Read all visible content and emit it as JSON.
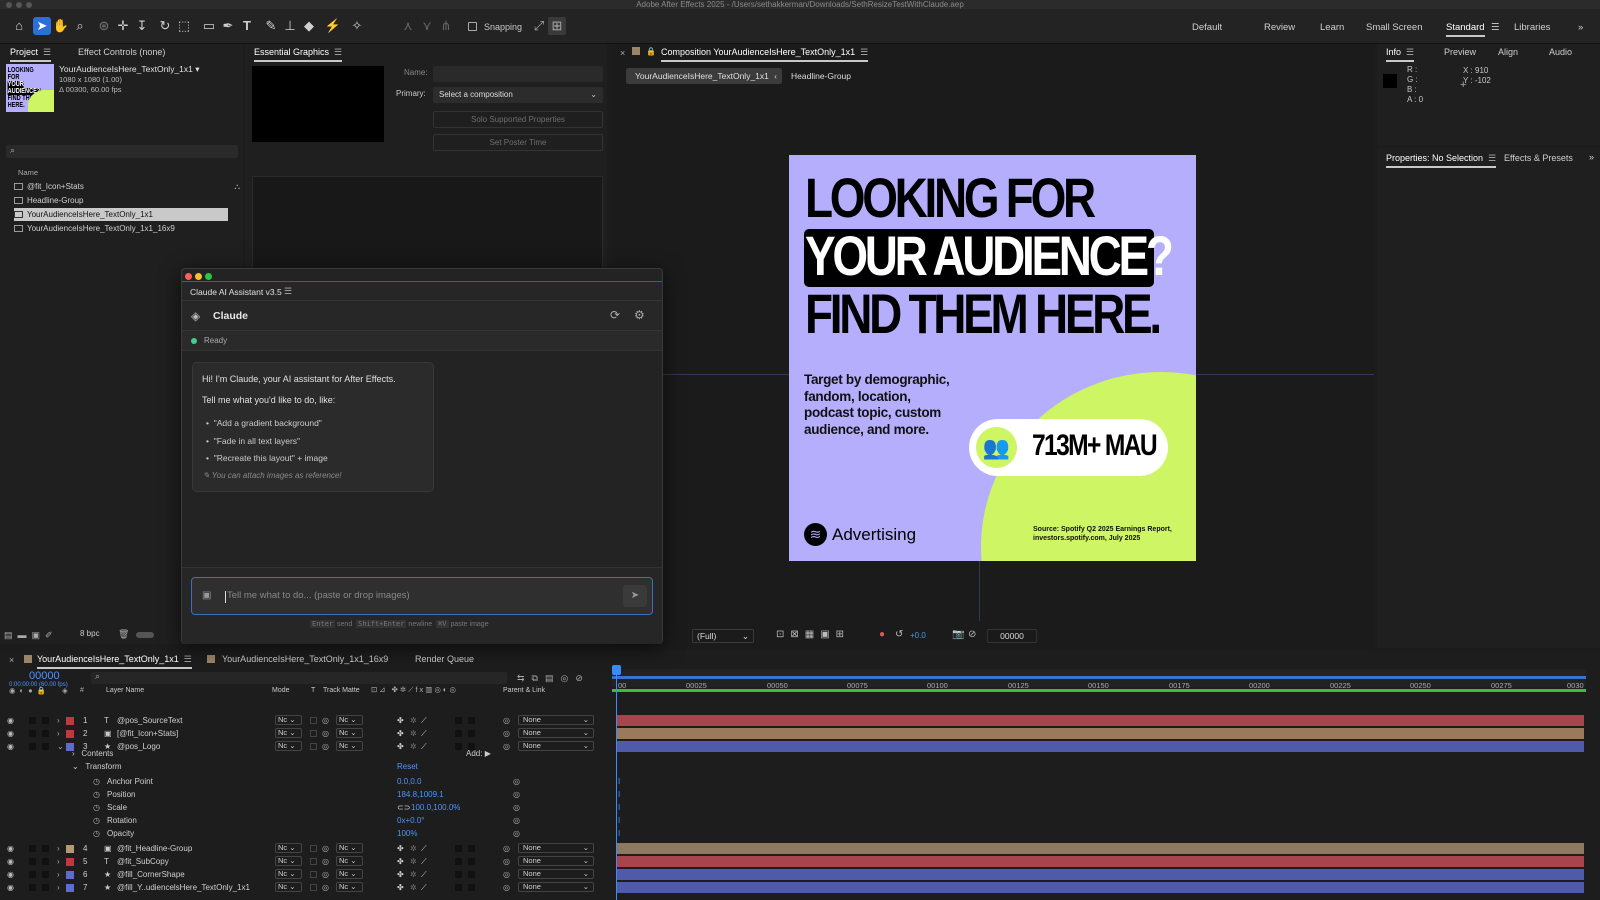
{
  "app": {
    "title": "Adobe After Effects 2025 - /Users/sethakkerman/Downloads/SethResizeTestWithClaude.aep"
  },
  "toolbar": {
    "snapping_label": "Snapping",
    "workspaces": [
      "Default",
      "Review",
      "Learn",
      "Small Screen",
      "Standard",
      "Libraries"
    ],
    "active_workspace": "Standard"
  },
  "project_panel": {
    "tab_project": "Project",
    "tab_effect_controls": "Effect Controls (none)",
    "selected_name": "YourAudienceIsHere_TextOnly_1x1 ▾",
    "selected_size": "1080 x 1080 (1.00)",
    "selected_duration": "Δ 00300, 60.00 fps",
    "col_name": "Name",
    "items": [
      "@fit_Icon+Stats",
      "Headline-Group",
      "YourAudienceIsHere_TextOnly_1x1",
      "YourAudienceIsHere_TextOnly_1x1_16x9"
    ],
    "bpc": "8 bpc"
  },
  "essential_graphics": {
    "tab": "Essential Graphics",
    "name_label": "Name:",
    "primary_label": "Primary:",
    "primary_value": "Select a composition",
    "solo_button": "Solo Supported Properties",
    "poster_button": "Set Poster Time"
  },
  "composition": {
    "tab": "Composition YourAudienceIsHere_TextOnly_1x1",
    "breadcrumb_active": "YourAudienceIsHere_TextOnly_1x1",
    "breadcrumb_next": "Headline-Group",
    "resolution": "(Full)",
    "exposure": "+0.0",
    "timecode": "00000",
    "artwork": {
      "line1": "LOOKING FOR",
      "line2": "YOUR AUDIENCE?",
      "line3": "FIND THEM HERE.",
      "body_lines": [
        "Target by demographic,",
        "fandom, location,",
        "podcast topic, custom",
        "audience, and more."
      ],
      "stat": "713M+ MAU",
      "brand": "Advertising",
      "source_lines": [
        "Source: Spotify Q2 2025 Earnings Report,",
        "investors.spotify.com, July 2025"
      ],
      "bg_color": "#b4aefc",
      "accent_color": "#cdf564"
    }
  },
  "info_panel": {
    "tabs": [
      "Info",
      "Preview",
      "Align",
      "Audio"
    ],
    "r": "R :",
    "g": "G :",
    "b": "B :",
    "a": "A : 0",
    "x": "X : 910",
    "y": "Y : -102"
  },
  "properties_panel": {
    "tab": "Properties: No Selection",
    "tab2": "Effects & Presets"
  },
  "claude_panel": {
    "window_title": "Claude AI Assistant v3.5",
    "header_name": "Claude",
    "status": "Ready",
    "greeting": "Hi! I'm Claude, your AI assistant for After Effects.",
    "prompt_intro": "Tell me what you'd like to do, like:",
    "suggestions": [
      "\"Add a gradient background\"",
      "\"Fade in all text layers\"",
      "\"Recreate this layout\" + image"
    ],
    "attach_hint": "You can attach images as reference!",
    "input_placeholder": "Tell me what to do... (paste or drop images)",
    "shortcut_enter_key": "Enter",
    "shortcut_enter": "send",
    "shortcut_newline_key": "Shift+Enter",
    "shortcut_newline": "newline",
    "shortcut_paste_key": "⌘V",
    "shortcut_paste": "paste image"
  },
  "timeline": {
    "tabs": [
      "YourAudienceIsHere_TextOnly_1x1",
      "YourAudienceIsHere_TextOnly_1x1_16x9",
      "Render Queue"
    ],
    "timecode": "00000",
    "timecode_sub": "0:00:00:00 (60.00 fps)",
    "headers": {
      "layer_name": "Layer Name",
      "mode": "Mode",
      "t": "T",
      "track_matte": "Track Matte",
      "parent": "Parent & Link"
    },
    "ruler_ticks": [
      "00025",
      "00050",
      "00075",
      "00100",
      "00125",
      "00150",
      "00175",
      "00200",
      "00225",
      "00250",
      "00275",
      "0030"
    ],
    "layers": [
      {
        "num": "1",
        "icon": "T",
        "name": "@pos_SourceText",
        "color": "#c0383e",
        "parent": "None",
        "bar": "#a8454c"
      },
      {
        "num": "2",
        "icon": "▣",
        "name": "[@fit_Icon+Stats]",
        "color": "#c0383e",
        "parent": "None",
        "bar": "#9a7a5a"
      },
      {
        "num": "3",
        "icon": "★",
        "name": "@pos_Logo",
        "color": "#5d6ad0",
        "parent": "None",
        "bar": "#4f5aa8"
      },
      {
        "num": "4",
        "icon": "▣",
        "name": "@fit_Headline-Group",
        "color": "#b49a70",
        "parent": "None",
        "bar": "#8f7860"
      },
      {
        "num": "5",
        "icon": "T",
        "name": "@fit_SubCopy",
        "color": "#c0383e",
        "parent": "None",
        "bar": "#a8454c"
      },
      {
        "num": "6",
        "icon": "★",
        "name": "@fill_CornerShape",
        "color": "#5d6ad0",
        "parent": "None",
        "bar": "#4f5aa8"
      },
      {
        "num": "7",
        "icon": "★",
        "name": "@fill_Y..udiencelsHere_TextOnly_1x1",
        "color": "#5d6ad0",
        "parent": "None",
        "bar": "#4f5aa8"
      }
    ],
    "mode_value": "Nc",
    "matte_value": "Nc",
    "contents_label": "Contents",
    "add_label": "Add:",
    "transform_label": "Transform",
    "reset_label": "Reset",
    "props": [
      {
        "name": "Anchor Point",
        "value": "0.0,0.0"
      },
      {
        "name": "Position",
        "value": "184.8,1009.1"
      },
      {
        "name": "Scale",
        "value": "100.0,100.0%"
      },
      {
        "name": "Rotation",
        "value": "0x+0.0°"
      },
      {
        "name": "Opacity",
        "value": "100%"
      }
    ]
  }
}
